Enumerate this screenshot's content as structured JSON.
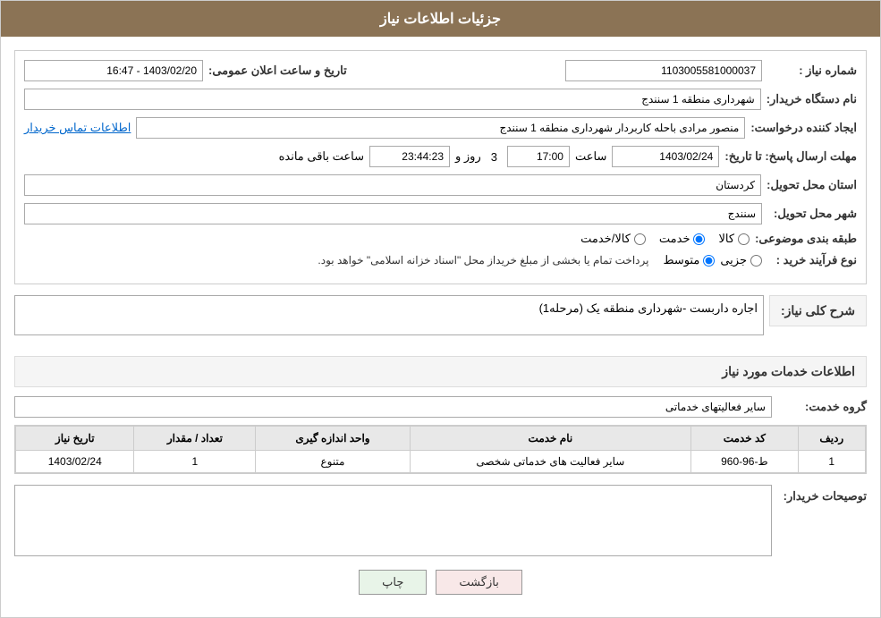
{
  "header": {
    "title": "جزئیات اطلاعات نیاز"
  },
  "fields": {
    "shomara_niaz_label": "شماره نیاز :",
    "shomara_niaz_value": "1103005581000037",
    "nam_dastgah_label": "نام دستگاه خریدار:",
    "nam_dastgah_value": "شهرداری منطقه 1 سنندج",
    "ijad_konande_label": "ایجاد کننده درخواست:",
    "ijad_konande_value": "منصور مرادی باحله کاربردار شهرداری منطقه 1 سنندج",
    "ijad_konande_link": "اطلاعات تماس خریدار",
    "mohlat_label": "مهلت ارسال پاسخ: تا تاریخ:",
    "mohlat_date": "1403/02/24",
    "mohlat_time_label": "ساعت",
    "mohlat_time": "17:00",
    "mohlat_roz_label": "روز و",
    "mohlat_roz": "3",
    "mohlat_saat_label": "ساعت باقی مانده",
    "mohlat_countdown": "23:44:23",
    "ostan_label": "استان محل تحویل:",
    "ostan_value": "کردستان",
    "shahr_label": "شهر محل تحویل:",
    "shahr_value": "سنندج",
    "tabaqe_label": "طبقه بندی موضوعی:",
    "tabaqe_options": [
      "کالا",
      "خدمت",
      "کالا/خدمت"
    ],
    "tabaqe_selected": "خدمت",
    "nooe_farayand_label": "نوع فرآیند خرید :",
    "nooe_farayand_options": [
      "جزیی",
      "متوسط"
    ],
    "nooe_farayand_note": "پرداخت تمام یا بخشی از مبلغ خریداز محل \"اسناد خزانه اسلامی\" خواهد بود.",
    "tarikh_saaat_label": "تاریخ و ساعت اعلان عمومی:",
    "tarikh_saaat_value": "1403/02/20 - 16:47"
  },
  "sharh_section": {
    "title": "شرح کلی نیاز:",
    "value": "اجاره داربست -شهرداری منطقه یک (مرحله1)"
  },
  "khadamat_section": {
    "title": "اطلاعات خدمات مورد نیاز",
    "group_label": "گروه خدمت:",
    "group_value": "سایر فعالیتهای خدماتی",
    "table": {
      "headers": [
        "ردیف",
        "کد خدمت",
        "نام خدمت",
        "واحد اندازه گیری",
        "تعداد / مقدار",
        "تاریخ نیاز"
      ],
      "rows": [
        {
          "radif": "1",
          "kod_khadamat": "ط-96-960",
          "nam_khadamat": "سایر فعالیت های خدماتی شخصی",
          "vahed": "متنوع",
          "tedad": "1",
          "tarikh": "1403/02/24"
        }
      ]
    }
  },
  "tosaifat_section": {
    "label": "توصیحات خریدار:",
    "placeholder": ""
  },
  "buttons": {
    "chap": "چاپ",
    "bazgasht": "بازگشت"
  }
}
